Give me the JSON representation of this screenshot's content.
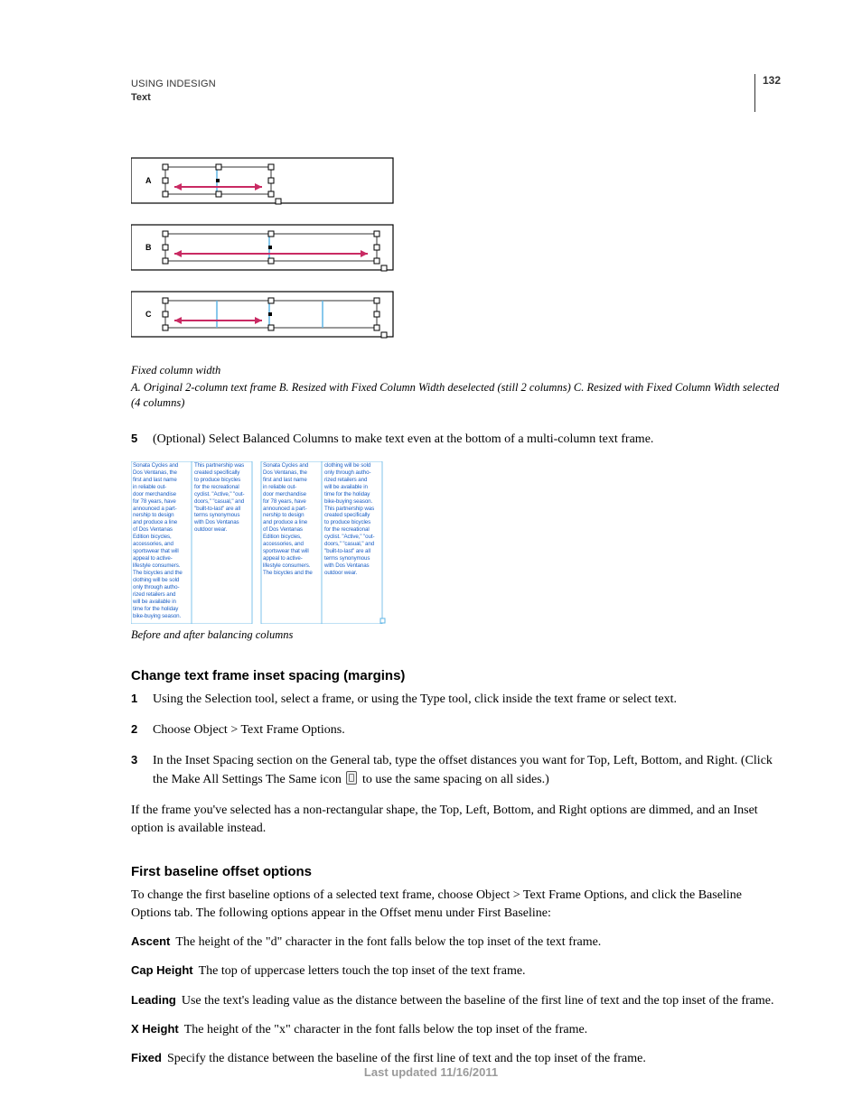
{
  "header": {
    "line1": "USING INDESIGN",
    "line2": "Text",
    "page_number": "132"
  },
  "figure1": {
    "labels": {
      "a": "A",
      "b": "B",
      "c": "C"
    },
    "caption_title": "Fixed column width",
    "caption_legend_a_label": "A.",
    "caption_legend_a_text": " Original 2-column text frame  ",
    "caption_legend_b_label": "B.",
    "caption_legend_b_text": " Resized with Fixed Column Width deselected (still 2 columns)  ",
    "caption_legend_c_label": "C.",
    "caption_legend_c_text": " Resized with Fixed Column Width selected (4 columns)"
  },
  "step5": {
    "num": "5",
    "text": "(Optional) Select Balanced Columns to make text even at the bottom of a multi-column text frame."
  },
  "balance_fig": {
    "caption": "Before and after balancing columns",
    "col1_text": "Sonata Cycles and\nDos Ventanas, the\nfirst and last name\nin reliable out-\ndoor merchandise\nfor 78 years, have\nannounced a part-\nnership to design\nand produce a line\nof Dos Ventanas\nEdition bicycles,\naccessories, and\nsportswear that will\nappeal to active-\nlifestyle consumers.\nThe bicycles and the\nclothing will be sold\nonly through autho-\nrized retailers and\nwill be available in\ntime for the holiday\nbike-buying season.",
    "col2_text": "This partnership was\ncreated specifically\nto produce bicycles\nfor the recreational\ncyclist. \"Active,\" \"out-\ndoors,\" \"casual,\" and\n\"built-to-last\" are all\nterms synonymous\nwith Dos Ventanas\noutdoor wear.",
    "col3_text": "Sonata Cycles and\nDos Ventanas, the\nfirst and last name\nin reliable out-\ndoor merchandise\nfor 78 years, have\nannounced a part-\nnership to design\nand produce a line\nof Dos Ventanas\nEdition bicycles,\naccessories, and\nsportswear that will\nappeal to active-\nlifestyle consumers.\nThe bicycles and the",
    "col4_text": "clothing will be sold\nonly through autho-\nrized retailers and\nwill be available in\ntime for the holiday\nbike-buying season.\nThis partnership was\ncreated specifically\nto produce bicycles\nfor the recreational\ncyclist. \"Active,\" \"out-\ndoors,\" \"casual,\" and\n\"built-to-last\" are all\nterms synonymous\nwith Dos Ventanas\noutdoor wear."
  },
  "section_inset": {
    "heading": "Change text frame inset spacing (margins)",
    "steps": [
      {
        "num": "1",
        "text": "Using the Selection tool, select a frame, or using the Type tool, click inside the text frame or select text."
      },
      {
        "num": "2",
        "text": "Choose Object > Text Frame Options."
      },
      {
        "num": "3",
        "text_before": "In the Inset Spacing section on the General tab, type the offset distances you want for Top, Left, Bottom, and Right. (Click the Make All Settings The Same icon ",
        "text_after": " to use the same spacing on all sides.)"
      }
    ],
    "para": "If the frame you've selected has a non-rectangular shape, the Top, Left, Bottom, and Right options are dimmed, and an Inset option is available instead."
  },
  "section_baseline": {
    "heading": "First baseline offset options",
    "intro": "To change the first baseline options of a selected text frame, choose Object > Text Frame Options, and click the Baseline Options tab. The following options appear in the Offset menu under First Baseline:",
    "defs": [
      {
        "term": "Ascent",
        "text": "The height of the \"d\" character in the font falls below the top inset of the text frame."
      },
      {
        "term": "Cap Height",
        "text": "The top of uppercase letters touch the top inset of the text frame."
      },
      {
        "term": "Leading",
        "text": "Use the text's leading value as the distance between the baseline of the first line of text and the top inset of the frame."
      },
      {
        "term": "X Height",
        "text": "The height of the \"x\" character in the font falls below the top inset of the frame."
      },
      {
        "term": "Fixed",
        "text": "Specify the distance between the baseline of the first line of text and the top inset of the frame."
      }
    ]
  },
  "footer": "Last updated 11/16/2011"
}
